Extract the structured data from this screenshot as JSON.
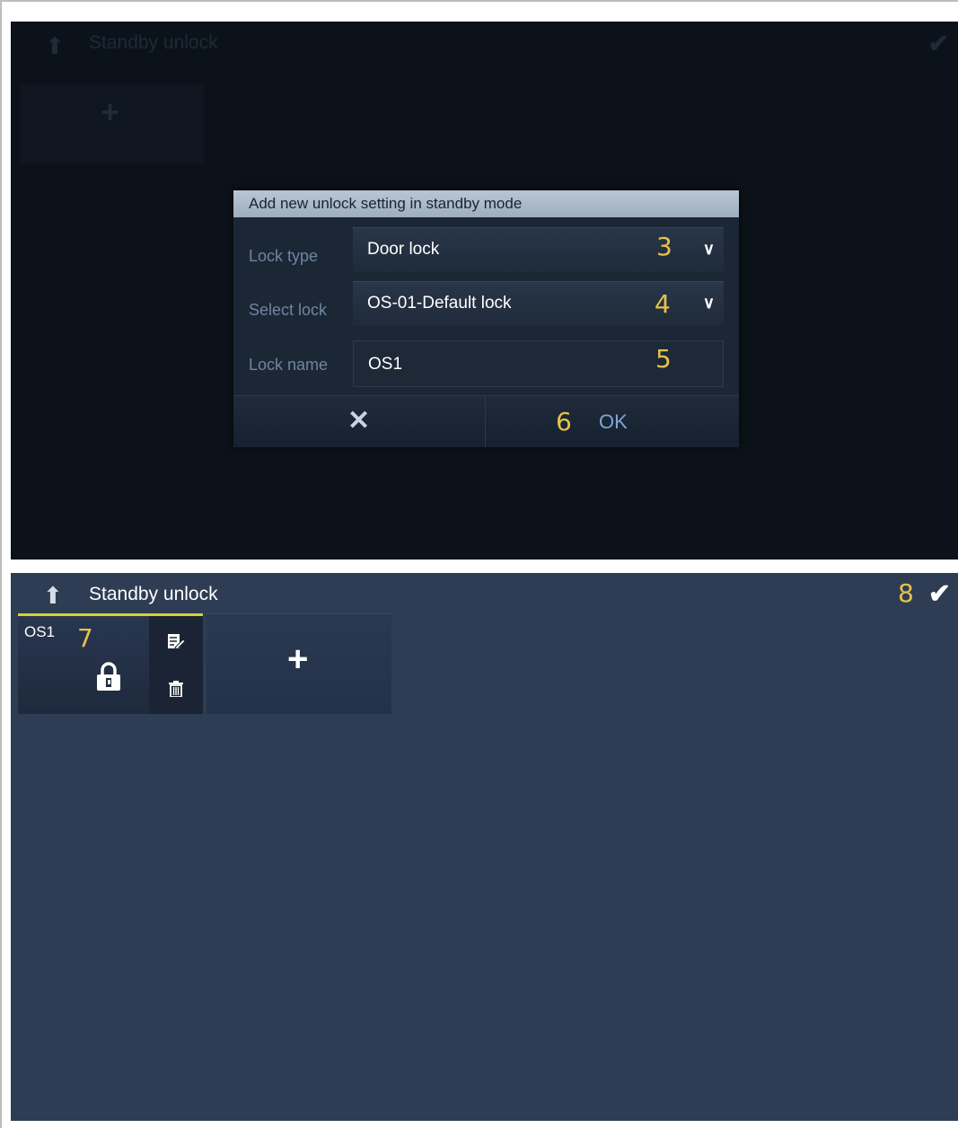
{
  "top_screen": {
    "header_title": "Standby unlock",
    "back_icon": "up-arrow-icon",
    "confirm_icon": "checkmark-icon",
    "add_icon": "plus-icon",
    "dialog": {
      "title": "Add new unlock setting in standby mode",
      "rows": [
        {
          "label": "Lock type",
          "value": "Door lock",
          "annotation": "3"
        },
        {
          "label": "Select lock",
          "value": "OS-01-Default lock",
          "annotation": "4"
        },
        {
          "label": "Lock name",
          "value": "OS1",
          "annotation": "5"
        }
      ],
      "cancel_icon": "close-icon",
      "ok_label": "OK",
      "ok_annotation": "6"
    }
  },
  "bottom_screen": {
    "header_title": "Standby unlock",
    "check_annotation": "8",
    "card": {
      "name": "OS1",
      "annotation": "7",
      "lock_icon": "padlock-icon",
      "edit_icon": "edit-icon",
      "delete_icon": "trash-icon"
    },
    "add_icon": "plus-icon"
  },
  "colors": {
    "annotation": "#e7c14a",
    "card_accent": "#d5d335",
    "background": "#2e3d54"
  }
}
